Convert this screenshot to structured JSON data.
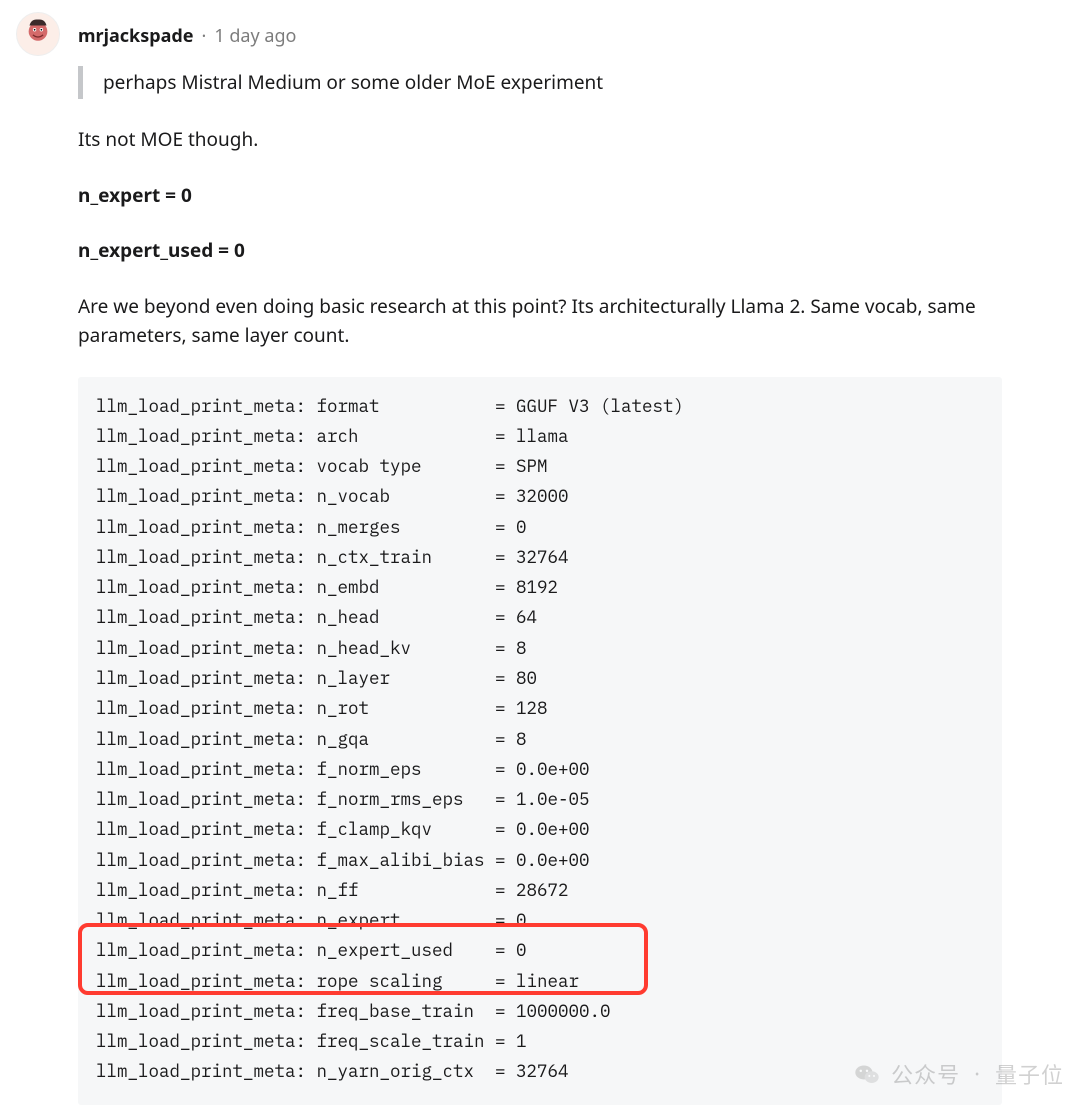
{
  "comment": {
    "username": "mrjackspade",
    "separator": "·",
    "age": "1 day ago",
    "quote": "perhaps Mistral Medium or some older MoE experiment",
    "p1": "Its not MOE though.",
    "bold1": "n_expert = 0",
    "bold2": "n_expert_used = 0",
    "p2": "Are we beyond even doing basic research at this point? Its architecturally Llama 2. Same vocab, same parameters, same layer count."
  },
  "code": {
    "prefix": "llm_load_print_meta:",
    "rows": [
      {
        "key": "format",
        "value": "GGUF V3 (latest)"
      },
      {
        "key": "arch",
        "value": "llama"
      },
      {
        "key": "vocab type",
        "value": "SPM"
      },
      {
        "key": "n_vocab",
        "value": "32000"
      },
      {
        "key": "n_merges",
        "value": "0"
      },
      {
        "key": "n_ctx_train",
        "value": "32764"
      },
      {
        "key": "n_embd",
        "value": "8192"
      },
      {
        "key": "n_head",
        "value": "64"
      },
      {
        "key": "n_head_kv",
        "value": "8"
      },
      {
        "key": "n_layer",
        "value": "80"
      },
      {
        "key": "n_rot",
        "value": "128"
      },
      {
        "key": "n_gqa",
        "value": "8"
      },
      {
        "key": "f_norm_eps",
        "value": "0.0e+00"
      },
      {
        "key": "f_norm_rms_eps",
        "value": "1.0e-05"
      },
      {
        "key": "f_clamp_kqv",
        "value": "0.0e+00"
      },
      {
        "key": "f_max_alibi_bias",
        "value": "0.0e+00"
      },
      {
        "key": "n_ff",
        "value": "28672"
      },
      {
        "key": "n_expert",
        "value": "0"
      },
      {
        "key": "n_expert_used",
        "value": "0"
      },
      {
        "key": "rope scaling",
        "value": "linear"
      },
      {
        "key": "freq_base_train",
        "value": "1000000.0"
      },
      {
        "key": "freq_scale_train",
        "value": "1"
      },
      {
        "key": "n_yarn_orig_ctx",
        "value": "32764"
      }
    ],
    "key_width": 17
  },
  "watermark": {
    "label": "公众号",
    "sep": "·",
    "source": "量子位"
  }
}
